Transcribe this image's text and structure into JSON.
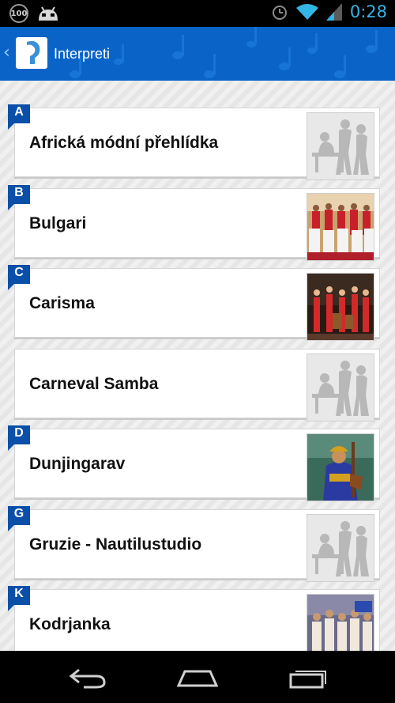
{
  "status_bar": {
    "battery_badge": "100",
    "time": "0:28"
  },
  "action_bar": {
    "title": "Interpreti",
    "accent_color": "#0a64c8"
  },
  "list": [
    {
      "letter": "A",
      "name": "Africká módní přehlídka",
      "image": "placeholder-silhouette"
    },
    {
      "letter": "B",
      "name": "Bulgari",
      "image": "photo-group-costumes"
    },
    {
      "letter": "C",
      "name": "Carisma",
      "image": "photo-band-red"
    },
    {
      "letter": "",
      "name": "Carneval Samba",
      "image": "placeholder-silhouette"
    },
    {
      "letter": "D",
      "name": "Dunjingarav",
      "image": "photo-musician"
    },
    {
      "letter": "G",
      "name": "Gruzie - Nautilustudio",
      "image": "placeholder-silhouette"
    },
    {
      "letter": "K",
      "name": "Kodrjanka",
      "image": "photo-group-stage"
    }
  ],
  "nav_bar": {
    "icons": [
      "back-icon",
      "home-icon",
      "recent-apps-icon"
    ]
  }
}
